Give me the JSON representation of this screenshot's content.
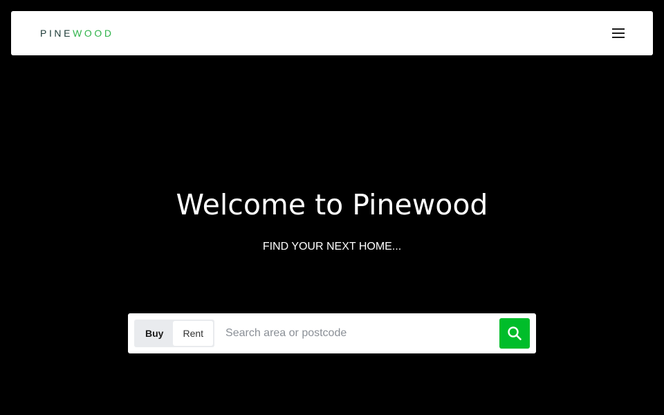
{
  "navbar": {
    "logo_dark": "PINE",
    "logo_green": "WOOD",
    "menu_icon": "hamburger-menu-icon"
  },
  "hero": {
    "title": "Welcome to Pinewood",
    "subtitle": "FIND YOUR NEXT HOME..."
  },
  "search": {
    "modes": [
      {
        "label": "Buy",
        "active": true
      },
      {
        "label": "Rent",
        "active": false
      }
    ],
    "placeholder": "Search area or postcode",
    "value": "",
    "button_icon": "search-icon"
  },
  "colors": {
    "accent": "#00bd2a",
    "logo_dark": "#1c3a36",
    "logo_green": "#2fb34a",
    "background": "#000000"
  }
}
